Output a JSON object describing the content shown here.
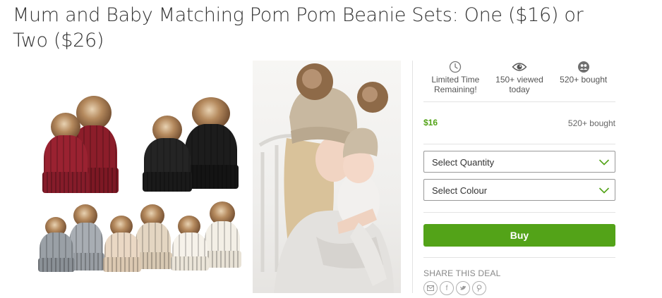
{
  "deal": {
    "title": "Mum and Baby Matching Pom Pom Beanie Sets: One ($16) or Two ($26)"
  },
  "gallery": {
    "images": [
      "beanie-sets-colors",
      "mother-and-baby-photo"
    ]
  },
  "stats": [
    {
      "icon": "clock-icon",
      "label": "Limited Time Remaining!"
    },
    {
      "icon": "eye-icon",
      "label": "150+ viewed today"
    },
    {
      "icon": "people-icon",
      "label": "520+ bought"
    }
  ],
  "option": {
    "price": "$16",
    "bought": "520+ bought"
  },
  "selects": {
    "quantity": "Select Quantity",
    "colour": "Select Colour"
  },
  "buy": {
    "label": "Buy"
  },
  "share": {
    "title": "SHARE THIS DEAL",
    "icons": [
      "email-icon",
      "facebook-icon",
      "twitter-icon",
      "pinterest-icon"
    ]
  },
  "colors": {
    "accent": "#53a318",
    "select_border": "#999999",
    "divider": "#e3e3e3"
  }
}
